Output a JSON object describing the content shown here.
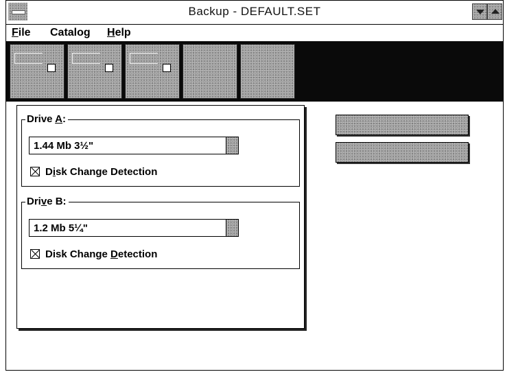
{
  "window": {
    "title": "Backup - DEFAULT.SET"
  },
  "menu": {
    "file": {
      "pre": "",
      "acc": "F",
      "post": "ile"
    },
    "catalog": {
      "pre": "Catalog",
      "acc": "",
      "post": ""
    },
    "help": {
      "pre": "",
      "acc": "H",
      "post": "elp"
    }
  },
  "toolbar": {
    "buttons": [
      {
        "icon": "floppy-drive-icon"
      },
      {
        "icon": "floppy-drive-icon"
      },
      {
        "icon": "floppy-drive-icon"
      },
      {
        "icon": ""
      },
      {
        "icon": ""
      }
    ]
  },
  "drive_a": {
    "label_pre": "Drive ",
    "label_acc": "A",
    "label_post": ":",
    "selected": "1.44 Mb 3½\"",
    "check_pre": "D",
    "check_acc": "i",
    "check_post": "sk Change Detection",
    "checked": true
  },
  "drive_b": {
    "label_pre": "Dri",
    "label_acc": "v",
    "label_post": "e B:",
    "selected": "1.2 Mb 5¼\"",
    "check_pre": "Disk Change ",
    "check_acc": "D",
    "check_post": "etection",
    "checked": true
  },
  "colors": {
    "title_bg": "#ffffff",
    "toolbar_bg": "#0a0a0a",
    "button_gray": "#9a9a9a"
  }
}
